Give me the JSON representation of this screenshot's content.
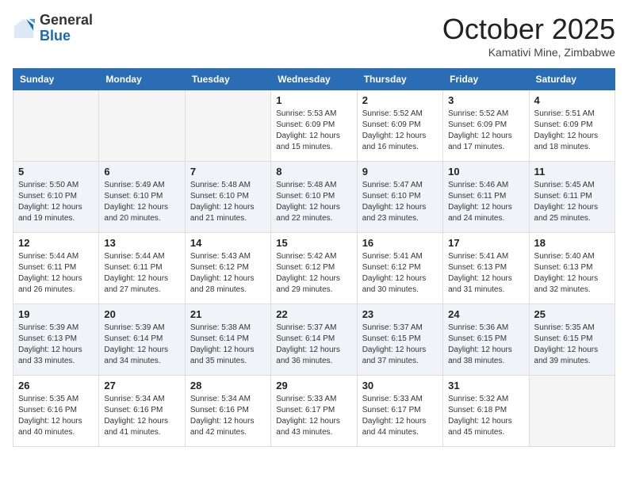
{
  "header": {
    "logo": {
      "line1": "General",
      "line2": "Blue"
    },
    "month": "October 2025",
    "location": "Kamativi Mine, Zimbabwe"
  },
  "weekdays": [
    "Sunday",
    "Monday",
    "Tuesday",
    "Wednesday",
    "Thursday",
    "Friday",
    "Saturday"
  ],
  "weeks": [
    [
      {
        "day": "",
        "info": ""
      },
      {
        "day": "",
        "info": ""
      },
      {
        "day": "",
        "info": ""
      },
      {
        "day": "1",
        "info": "Sunrise: 5:53 AM\nSunset: 6:09 PM\nDaylight: 12 hours\nand 15 minutes."
      },
      {
        "day": "2",
        "info": "Sunrise: 5:52 AM\nSunset: 6:09 PM\nDaylight: 12 hours\nand 16 minutes."
      },
      {
        "day": "3",
        "info": "Sunrise: 5:52 AM\nSunset: 6:09 PM\nDaylight: 12 hours\nand 17 minutes."
      },
      {
        "day": "4",
        "info": "Sunrise: 5:51 AM\nSunset: 6:09 PM\nDaylight: 12 hours\nand 18 minutes."
      }
    ],
    [
      {
        "day": "5",
        "info": "Sunrise: 5:50 AM\nSunset: 6:10 PM\nDaylight: 12 hours\nand 19 minutes."
      },
      {
        "day": "6",
        "info": "Sunrise: 5:49 AM\nSunset: 6:10 PM\nDaylight: 12 hours\nand 20 minutes."
      },
      {
        "day": "7",
        "info": "Sunrise: 5:48 AM\nSunset: 6:10 PM\nDaylight: 12 hours\nand 21 minutes."
      },
      {
        "day": "8",
        "info": "Sunrise: 5:48 AM\nSunset: 6:10 PM\nDaylight: 12 hours\nand 22 minutes."
      },
      {
        "day": "9",
        "info": "Sunrise: 5:47 AM\nSunset: 6:10 PM\nDaylight: 12 hours\nand 23 minutes."
      },
      {
        "day": "10",
        "info": "Sunrise: 5:46 AM\nSunset: 6:11 PM\nDaylight: 12 hours\nand 24 minutes."
      },
      {
        "day": "11",
        "info": "Sunrise: 5:45 AM\nSunset: 6:11 PM\nDaylight: 12 hours\nand 25 minutes."
      }
    ],
    [
      {
        "day": "12",
        "info": "Sunrise: 5:44 AM\nSunset: 6:11 PM\nDaylight: 12 hours\nand 26 minutes."
      },
      {
        "day": "13",
        "info": "Sunrise: 5:44 AM\nSunset: 6:11 PM\nDaylight: 12 hours\nand 27 minutes."
      },
      {
        "day": "14",
        "info": "Sunrise: 5:43 AM\nSunset: 6:12 PM\nDaylight: 12 hours\nand 28 minutes."
      },
      {
        "day": "15",
        "info": "Sunrise: 5:42 AM\nSunset: 6:12 PM\nDaylight: 12 hours\nand 29 minutes."
      },
      {
        "day": "16",
        "info": "Sunrise: 5:41 AM\nSunset: 6:12 PM\nDaylight: 12 hours\nand 30 minutes."
      },
      {
        "day": "17",
        "info": "Sunrise: 5:41 AM\nSunset: 6:13 PM\nDaylight: 12 hours\nand 31 minutes."
      },
      {
        "day": "18",
        "info": "Sunrise: 5:40 AM\nSunset: 6:13 PM\nDaylight: 12 hours\nand 32 minutes."
      }
    ],
    [
      {
        "day": "19",
        "info": "Sunrise: 5:39 AM\nSunset: 6:13 PM\nDaylight: 12 hours\nand 33 minutes."
      },
      {
        "day": "20",
        "info": "Sunrise: 5:39 AM\nSunset: 6:14 PM\nDaylight: 12 hours\nand 34 minutes."
      },
      {
        "day": "21",
        "info": "Sunrise: 5:38 AM\nSunset: 6:14 PM\nDaylight: 12 hours\nand 35 minutes."
      },
      {
        "day": "22",
        "info": "Sunrise: 5:37 AM\nSunset: 6:14 PM\nDaylight: 12 hours\nand 36 minutes."
      },
      {
        "day": "23",
        "info": "Sunrise: 5:37 AM\nSunset: 6:15 PM\nDaylight: 12 hours\nand 37 minutes."
      },
      {
        "day": "24",
        "info": "Sunrise: 5:36 AM\nSunset: 6:15 PM\nDaylight: 12 hours\nand 38 minutes."
      },
      {
        "day": "25",
        "info": "Sunrise: 5:35 AM\nSunset: 6:15 PM\nDaylight: 12 hours\nand 39 minutes."
      }
    ],
    [
      {
        "day": "26",
        "info": "Sunrise: 5:35 AM\nSunset: 6:16 PM\nDaylight: 12 hours\nand 40 minutes."
      },
      {
        "day": "27",
        "info": "Sunrise: 5:34 AM\nSunset: 6:16 PM\nDaylight: 12 hours\nand 41 minutes."
      },
      {
        "day": "28",
        "info": "Sunrise: 5:34 AM\nSunset: 6:16 PM\nDaylight: 12 hours\nand 42 minutes."
      },
      {
        "day": "29",
        "info": "Sunrise: 5:33 AM\nSunset: 6:17 PM\nDaylight: 12 hours\nand 43 minutes."
      },
      {
        "day": "30",
        "info": "Sunrise: 5:33 AM\nSunset: 6:17 PM\nDaylight: 12 hours\nand 44 minutes."
      },
      {
        "day": "31",
        "info": "Sunrise: 5:32 AM\nSunset: 6:18 PM\nDaylight: 12 hours\nand 45 minutes."
      },
      {
        "day": "",
        "info": ""
      }
    ]
  ]
}
